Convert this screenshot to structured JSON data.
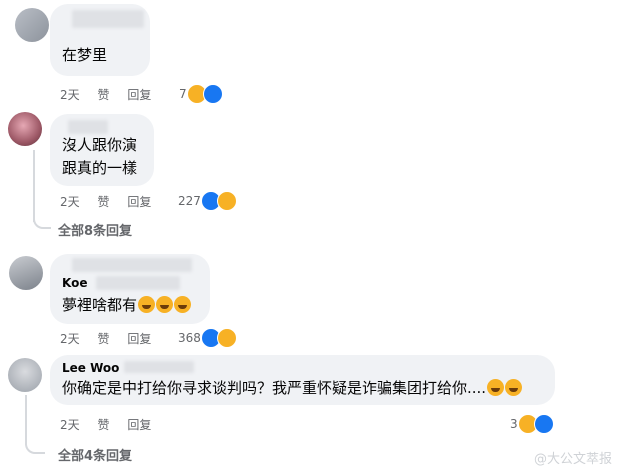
{
  "comments": [
    {
      "name": "",
      "text_lines": [
        "在梦里"
      ],
      "time": "2天",
      "like_label": "赞",
      "reply_label": "回复",
      "reaction_count": "7",
      "reactions": [
        "haha-icon",
        "like-icon"
      ]
    },
    {
      "name": "",
      "text_lines": [
        "沒人跟你演",
        "跟真的一樣"
      ],
      "time": "2天",
      "like_label": "赞",
      "reply_label": "回复",
      "reaction_count": "227",
      "reactions": [
        "like-icon",
        "haha-icon"
      ],
      "replies_label": "全部8条回复"
    },
    {
      "name": "Koe",
      "text_lines": [
        "夢裡啥都有"
      ],
      "time": "2天",
      "like_label": "赞",
      "reply_label": "回复",
      "reaction_count": "368",
      "reactions": [
        "like-icon",
        "haha-icon"
      ]
    },
    {
      "name": "Lee Woo",
      "text_lines": [
        "你确定是中打给你寻求谈判吗？我严重怀疑是诈骗集团打给你...."
      ],
      "time": "2天",
      "like_label": "赞",
      "reply_label": "回复",
      "reaction_count": "3",
      "reactions": [
        "haha-icon",
        "like-icon"
      ],
      "replies_label": "全部4条回复"
    }
  ],
  "watermark": "@大公文萃报",
  "colors": {
    "bubble": "#f0f2f5",
    "meta": "#65676b",
    "like": "#1877f2",
    "haha": "#f7b125"
  }
}
